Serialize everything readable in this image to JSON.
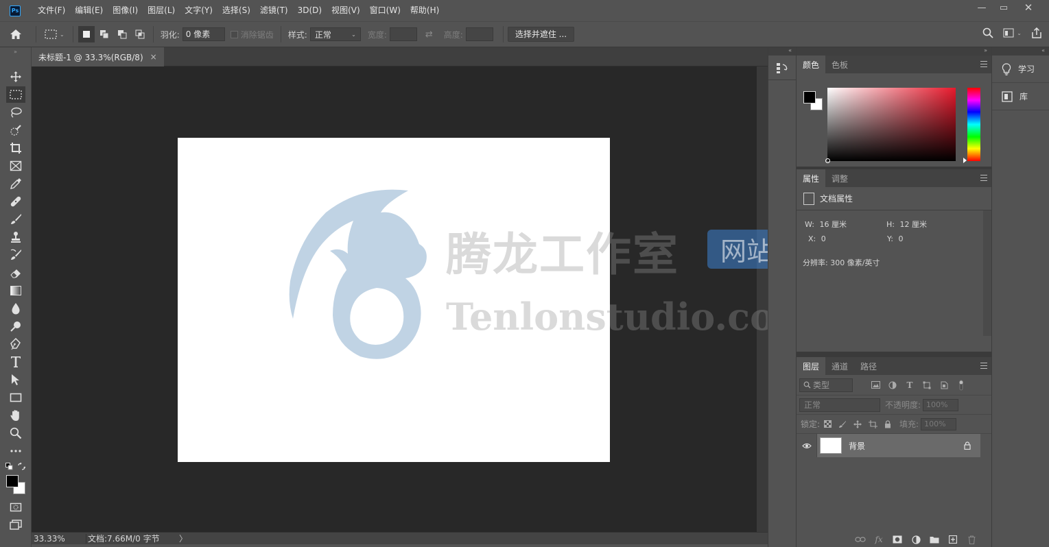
{
  "app": {
    "logo_text": "Ps",
    "colors": {
      "accent": "#31a8ff",
      "chrome": "#535353",
      "pasteboard": "#282828",
      "canvas": "#ffffff"
    }
  },
  "menu": {
    "items": [
      "文件(F)",
      "编辑(E)",
      "图像(I)",
      "图层(L)",
      "文字(Y)",
      "选择(S)",
      "滤镜(T)",
      "3D(D)",
      "视图(V)",
      "窗口(W)",
      "帮助(H)"
    ]
  },
  "window_controls": {
    "minimize": "—",
    "maximize": "▭",
    "close": "✕"
  },
  "options": {
    "feather_label": "羽化:",
    "feather_value": "0 像素",
    "antialias_label": "消除锯齿",
    "style_label": "样式:",
    "style_value": "正常",
    "width_label": "宽度:",
    "height_label": "高度:",
    "select_mask_label": "选择并遮住 ..."
  },
  "document": {
    "tab_title": "未标题-1 @ 33.3%(RGB/8)",
    "tab_close": "×",
    "zoom": "33.33%",
    "doc_info": "文档:7.66M/0 字节",
    "status_arrow": "〉"
  },
  "watermark": {
    "title": "腾龙工作室",
    "badge": "网站",
    "url": "Tenlonstudio.com"
  },
  "color_panel": {
    "tabs": [
      "颜色",
      "色板"
    ],
    "active": 0
  },
  "properties_panel": {
    "tabs": [
      "属性",
      "调整"
    ],
    "header": "文档属性",
    "w_label": "W:",
    "w_value": "16 厘米",
    "h_label": "H:",
    "h_value": "12 厘米",
    "x_label": "X:",
    "x_value": "0",
    "y_label": "Y:",
    "y_value": "0",
    "resolution": "分辨率: 300 像素/英寸"
  },
  "layers_panel": {
    "tabs": [
      "图层",
      "通道",
      "路径"
    ],
    "kind_placeholder": "类型",
    "blend_mode": "正常",
    "opacity_label": "不透明度:",
    "opacity_value": "100%",
    "lock_label": "锁定:",
    "fill_label": "填充:",
    "fill_value": "100%",
    "layer_name": "背景"
  },
  "far_right": {
    "learn": "学习",
    "library": "库"
  }
}
